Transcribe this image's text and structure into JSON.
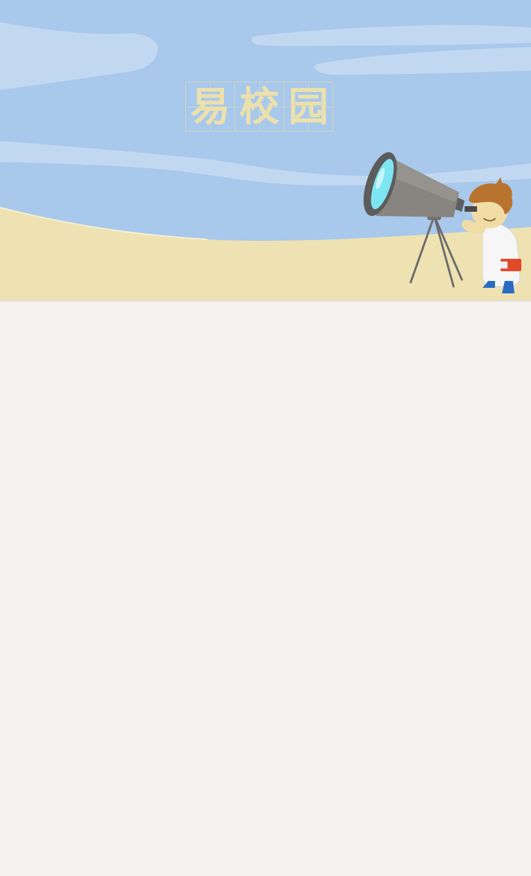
{
  "app": {
    "logo_chars": [
      "易",
      "校",
      "园"
    ]
  },
  "colors": {
    "sky": "#a8c8ec",
    "cloud": "#c2d8f0",
    "sand": "#eee2b2",
    "logo_text": "#ece0ac",
    "background": "#f7f2f2"
  },
  "illustration": {
    "icons": [
      "telescope-icon",
      "astronomer-character"
    ]
  }
}
